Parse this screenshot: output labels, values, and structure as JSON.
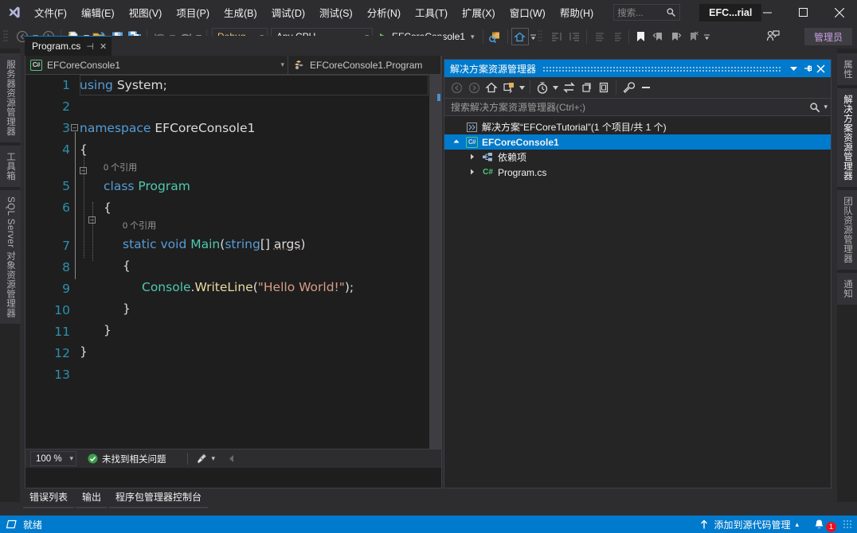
{
  "window": {
    "title": "EFC...rial",
    "search_placeholder": "搜索...",
    "minimize": "—",
    "maximize": "▢",
    "close": "✕"
  },
  "menu": {
    "items": [
      {
        "label": "文件(F)"
      },
      {
        "label": "编辑(E)"
      },
      {
        "label": "视图(V)"
      },
      {
        "label": "项目(P)"
      },
      {
        "label": "生成(B)"
      },
      {
        "label": "调试(D)"
      },
      {
        "label": "测试(S)"
      },
      {
        "label": "分析(N)"
      },
      {
        "label": "工具(T)"
      },
      {
        "label": "扩展(X)"
      },
      {
        "label": "窗口(W)"
      },
      {
        "label": "帮助(H)"
      }
    ]
  },
  "toolbar": {
    "config": "Debug",
    "platform": "Any CPU",
    "run_target": "EFCoreConsole1",
    "admin_label": "管理员",
    "icons": {
      "back": "navigate-back-icon",
      "forward": "navigate-forward-icon",
      "new_project": "new-project-icon",
      "open_file": "open-file-icon",
      "save": "save-icon",
      "save_all": "save-all-icon",
      "undo": "undo-icon",
      "redo": "redo-icon",
      "start": "start-debug-icon",
      "find": "find-icon",
      "home": "home-icon",
      "bookmark": "bookmark-icon"
    }
  },
  "left_rail": {
    "tabs": [
      {
        "label": "服务器资源管理器"
      },
      {
        "label": "工具箱"
      },
      {
        "label": "SQL Server 对象资源管理器"
      }
    ]
  },
  "right_rail": {
    "tabs": [
      {
        "label": "属性",
        "active": false
      },
      {
        "label": "解决方案资源管理器",
        "active": true
      },
      {
        "label": "团队资源管理器",
        "active": false
      },
      {
        "label": "通知",
        "active": false
      }
    ]
  },
  "editor": {
    "tab_label": "Program.cs",
    "nav_project": "EFCoreConsole1",
    "nav_member": "EFCoreConsole1.Program",
    "line_numbers": [
      "1",
      "2",
      "3",
      "4",
      "5",
      "6",
      "7",
      "8",
      "9",
      "10",
      "11",
      "12",
      "13"
    ],
    "reference_hint_1": "0 个引用",
    "reference_hint_2": "0 个引用",
    "code_lines": [
      "using System;",
      "",
      "namespace EFCoreConsole1",
      "{",
      "    class Program",
      "    {",
      "        static void Main(string[] args)",
      "        {",
      "            Console.WriteLine(\"Hello World!\");",
      "        }",
      "    }",
      "}",
      ""
    ],
    "status": {
      "zoom": "100 %",
      "issues": "未找到相关问题"
    }
  },
  "solution_explorer": {
    "title": "解决方案资源管理器",
    "search_placeholder": "搜索解决方案资源管理器(Ctrl+;)",
    "tree": [
      {
        "label": "解决方案“EFCoreTutorial”(1 个项目/共 1 个)",
        "icon": "solution-icon",
        "indent": 0,
        "expander": "",
        "bold": false,
        "selected": false
      },
      {
        "label": "EFCoreConsole1",
        "icon": "csharp-project-icon",
        "indent": 1,
        "expander": "▴",
        "bold": true,
        "selected": true
      },
      {
        "label": "依赖项",
        "icon": "dependencies-icon",
        "indent": 2,
        "expander": "▹",
        "bold": false,
        "selected": false
      },
      {
        "label": "Program.cs",
        "icon": "csharp-file-icon",
        "indent": 2,
        "expander": "▹",
        "bold": false,
        "selected": false
      }
    ]
  },
  "bottom_tabs": {
    "items": [
      {
        "label": "错误列表"
      },
      {
        "label": "输出"
      },
      {
        "label": "程序包管理器控制台"
      }
    ]
  },
  "statusbar": {
    "state": "就绪",
    "source_control": "添加到源代码管理",
    "notification_count": "1"
  },
  "colors": {
    "accent": "#007acc",
    "chrome": "#2d2d30",
    "panel": "#252526",
    "editor_bg": "#1e1e1e",
    "keyword": "#569cd6",
    "type": "#4ec9b0",
    "string": "#d69d85",
    "linenumber": "#2b91af",
    "error_badge": "#e81123"
  }
}
